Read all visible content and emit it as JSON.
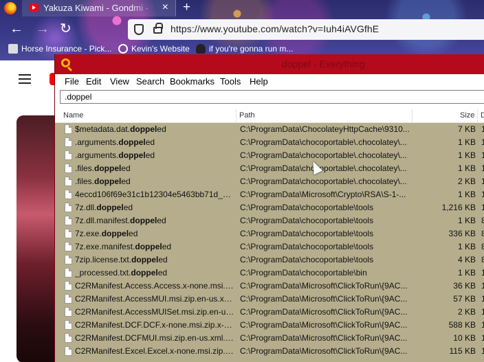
{
  "browser": {
    "tab_title": "Yakuza Kiwami - Gondmi - YouTube",
    "tab_close": "×",
    "new_tab": "+",
    "url": "https://www.youtube.com/watch?v=Iuh4iAVGfhE",
    "nav": {
      "back": "←",
      "forward": "→",
      "reload": "↻"
    },
    "bookmarks": [
      {
        "label": "Horse Insurance - Pick...",
        "icon": "horse-icon"
      },
      {
        "label": "Kevin's Website",
        "icon": "globe-icon"
      },
      {
        "label": "if you're gonna run m...",
        "icon": "character-icon"
      }
    ]
  },
  "everything": {
    "title": "doppel - Everything",
    "menu": [
      "File",
      "Edit",
      "View",
      "Search",
      "Bookmarks",
      "Tools",
      "Help"
    ],
    "search_value": ".doppel",
    "columns": {
      "name": "Name",
      "path": "Path",
      "size": "Size",
      "extra": "D"
    },
    "rows": [
      {
        "pre": "$metadata.dat.",
        "match": "doppel",
        "post": "ed",
        "path": "C:\\ProgramData\\ChocolateyHttpCache\\9310...",
        "size": "7 KB",
        "extra": "1"
      },
      {
        "pre": ".arguments.",
        "match": "doppel",
        "post": "ed",
        "path": "C:\\ProgramData\\chocoportable\\.chocolatey\\...",
        "size": "1 KB",
        "extra": "1"
      },
      {
        "pre": ".arguments.",
        "match": "doppel",
        "post": "ed",
        "path": "C:\\ProgramData\\chocoportable\\.chocolatey\\...",
        "size": "1 KB",
        "extra": "1"
      },
      {
        "pre": ".files.",
        "match": "doppel",
        "post": "ed",
        "path": "C:\\ProgramData\\chocoportable\\.chocolatey\\...",
        "size": "1 KB",
        "extra": "1"
      },
      {
        "pre": ".files.",
        "match": "doppel",
        "post": "ed",
        "path": "C:\\ProgramData\\chocoportable\\.chocolatey\\...",
        "size": "2 KB",
        "extra": "1"
      },
      {
        "pre": "4eccd106f69e31c1b12304e5463bb71d_48e...",
        "match": "",
        "post": "",
        "path": "C:\\ProgramData\\Microsoft\\Crypto\\RSA\\S-1-...",
        "size": "1 KB",
        "extra": "1"
      },
      {
        "pre": "7z.dll.",
        "match": "doppel",
        "post": "ed",
        "path": "C:\\ProgramData\\chocoportable\\tools",
        "size": "1,216 KB",
        "extra": "1"
      },
      {
        "pre": "7z.dll.manifest.",
        "match": "doppel",
        "post": "ed",
        "path": "C:\\ProgramData\\chocoportable\\tools",
        "size": "1 KB",
        "extra": "8"
      },
      {
        "pre": "7z.exe.",
        "match": "doppel",
        "post": "ed",
        "path": "C:\\ProgramData\\chocoportable\\tools",
        "size": "336 KB",
        "extra": "8"
      },
      {
        "pre": "7z.exe.manifest.",
        "match": "doppel",
        "post": "ed",
        "path": "C:\\ProgramData\\chocoportable\\tools",
        "size": "1 KB",
        "extra": "8"
      },
      {
        "pre": "7zip.license.txt.",
        "match": "doppel",
        "post": "ed",
        "path": "C:\\ProgramData\\chocoportable\\tools",
        "size": "4 KB",
        "extra": "8"
      },
      {
        "pre": "_processed.txt.",
        "match": "doppel",
        "post": "ed",
        "path": "C:\\ProgramData\\chocoportable\\bin",
        "size": "1 KB",
        "extra": "1"
      },
      {
        "pre": "C2RManifest.Access.Access.x-none.msi.zi...",
        "match": "",
        "post": "",
        "path": "C:\\ProgramData\\Microsoft\\ClickToRun\\{9AC...",
        "size": "36 KB",
        "extra": "1"
      },
      {
        "pre": "C2RManifest.AccessMUI.msi.zip.en-us.xml...",
        "match": "",
        "post": "",
        "path": "C:\\ProgramData\\Microsoft\\ClickToRun\\{9AC...",
        "size": "57 KB",
        "extra": "1"
      },
      {
        "pre": "C2RManifest.AccessMUISet.msi.zip.en-us....",
        "match": "",
        "post": "",
        "path": "C:\\ProgramData\\Microsoft\\ClickToRun\\{9AC...",
        "size": "2 KB",
        "extra": "1"
      },
      {
        "pre": "C2RManifest.DCF.DCF.x-none.msi.zip.x-n...",
        "match": "",
        "post": "",
        "path": "C:\\ProgramData\\Microsoft\\ClickToRun\\{9AC...",
        "size": "588 KB",
        "extra": "1"
      },
      {
        "pre": "C2RManifest.DCFMUI.msi.zip.en-us.xml.",
        "match": "d...",
        "post": "",
        "path": "C:\\ProgramData\\Microsoft\\ClickToRun\\{9AC...",
        "size": "10 KB",
        "extra": "1"
      },
      {
        "pre": "C2RManifest.Excel.Excel.x-none.msi.zip.x-...",
        "match": "",
        "post": "",
        "path": "C:\\ProgramData\\Microsoft\\ClickToRun\\{9AC...",
        "size": "115 KB",
        "extra": "1"
      }
    ]
  }
}
